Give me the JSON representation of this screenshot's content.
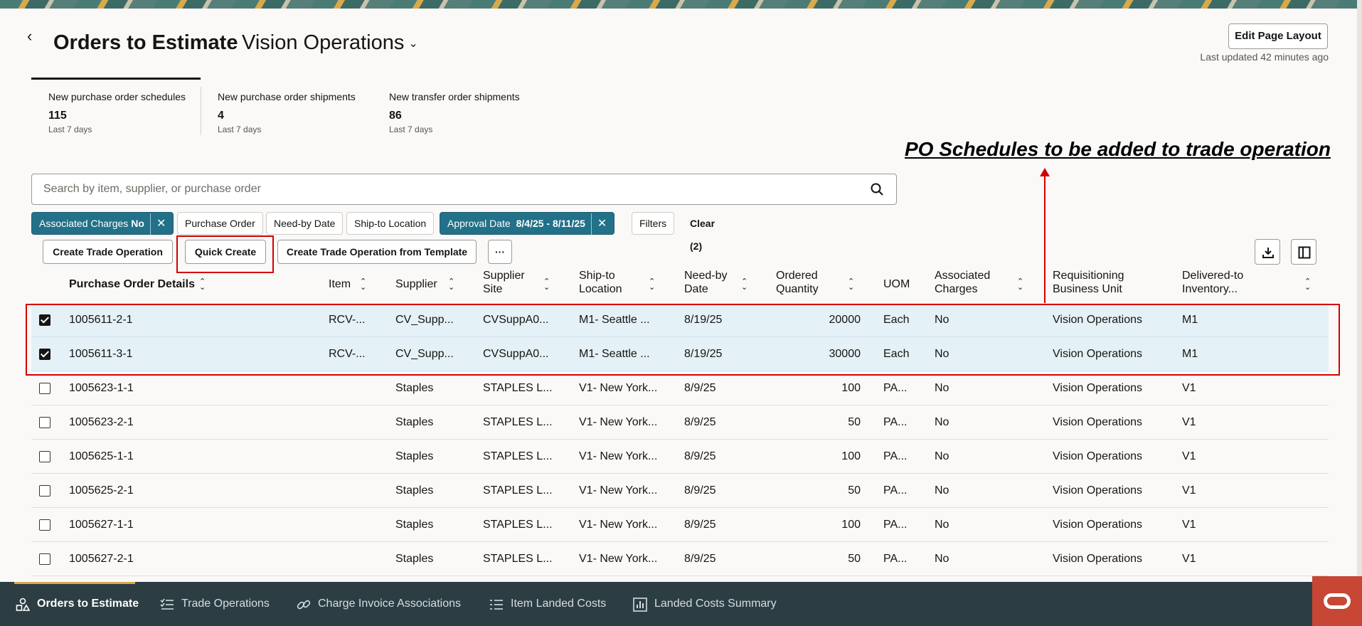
{
  "header": {
    "title": "Orders to Estimate",
    "context": "Vision Operations",
    "edit_layout_label": "Edit Page Layout",
    "last_updated": "Last updated 42 minutes ago"
  },
  "metrics": [
    {
      "label": "New purchase order schedules",
      "value": "115",
      "sub": "Last 7 days"
    },
    {
      "label": "New purchase order shipments",
      "value": "4",
      "sub": "Last 7 days"
    },
    {
      "label": "New transfer order shipments",
      "value": "86",
      "sub": "Last 7 days"
    }
  ],
  "annotation": "PO Schedules to be added to trade operation",
  "search": {
    "placeholder": "Search by item, supplier, or purchase order"
  },
  "chips": [
    {
      "label": "Associated Charges",
      "value": "No",
      "active": true
    },
    {
      "label": "Purchase Order"
    },
    {
      "label": "Need-by Date"
    },
    {
      "label": "Ship-to Location"
    },
    {
      "label": "Approval Date",
      "value": "8/4/25 - 8/11/25",
      "active": true
    },
    {
      "label": "Filters"
    }
  ],
  "clear_label": "Clear (2)",
  "toolbar": {
    "create_trade_operation": "Create Trade Operation",
    "quick_create": "Quick Create",
    "create_from_template": "Create Trade Operation from Template",
    "more": "···"
  },
  "columns": {
    "po_details": "Purchase Order Details",
    "item": "Item",
    "supplier": "Supplier",
    "supplier_site": "Supplier Site",
    "ship_to": "Ship-to Location",
    "need_by": "Need-by Date",
    "ordered_qty": "Ordered Quantity",
    "uom": "UOM",
    "assoc_charges": "Associated Charges",
    "req_bu": "Requisitioning Business Unit",
    "delivered_to": "Delivered-to Inventory..."
  },
  "rows": [
    {
      "po": "1005611-2-1",
      "item": "RCV-...",
      "supplier": "CV_Supp...",
      "site": "CVSuppA0...",
      "ship_to": "M1- Seattle ...",
      "need_by": "8/19/25",
      "qty": "20000",
      "uom": "Each",
      "charges": "No",
      "bu": "Vision Operations",
      "delivered": "M1",
      "selected": true
    },
    {
      "po": "1005611-3-1",
      "item": "RCV-...",
      "supplier": "CV_Supp...",
      "site": "CVSuppA0...",
      "ship_to": "M1- Seattle ...",
      "need_by": "8/19/25",
      "qty": "30000",
      "uom": "Each",
      "charges": "No",
      "bu": "Vision Operations",
      "delivered": "M1",
      "selected": true
    },
    {
      "po": "1005623-1-1",
      "item": "",
      "supplier": "Staples",
      "site": "STAPLES L...",
      "ship_to": "V1- New York...",
      "need_by": "8/9/25",
      "qty": "100",
      "uom": "PA...",
      "charges": "No",
      "bu": "Vision Operations",
      "delivered": "V1",
      "selected": false
    },
    {
      "po": "1005623-2-1",
      "item": "",
      "supplier": "Staples",
      "site": "STAPLES L...",
      "ship_to": "V1- New York...",
      "need_by": "8/9/25",
      "qty": "50",
      "uom": "PA...",
      "charges": "No",
      "bu": "Vision Operations",
      "delivered": "V1",
      "selected": false
    },
    {
      "po": "1005625-1-1",
      "item": "",
      "supplier": "Staples",
      "site": "STAPLES L...",
      "ship_to": "V1- New York...",
      "need_by": "8/9/25",
      "qty": "100",
      "uom": "PA...",
      "charges": "No",
      "bu": "Vision Operations",
      "delivered": "V1",
      "selected": false
    },
    {
      "po": "1005625-2-1",
      "item": "",
      "supplier": "Staples",
      "site": "STAPLES L...",
      "ship_to": "V1- New York...",
      "need_by": "8/9/25",
      "qty": "50",
      "uom": "PA...",
      "charges": "No",
      "bu": "Vision Operations",
      "delivered": "V1",
      "selected": false
    },
    {
      "po": "1005627-1-1",
      "item": "",
      "supplier": "Staples",
      "site": "STAPLES L...",
      "ship_to": "V1- New York...",
      "need_by": "8/9/25",
      "qty": "100",
      "uom": "PA...",
      "charges": "No",
      "bu": "Vision Operations",
      "delivered": "V1",
      "selected": false
    },
    {
      "po": "1005627-2-1",
      "item": "",
      "supplier": "Staples",
      "site": "STAPLES L...",
      "ship_to": "V1- New York...",
      "need_by": "8/9/25",
      "qty": "50",
      "uom": "PA...",
      "charges": "No",
      "bu": "Vision Operations",
      "delivered": "V1",
      "selected": false
    }
  ],
  "nav": [
    {
      "label": "Orders to Estimate",
      "icon": "shapes-icon",
      "active": true
    },
    {
      "label": "Trade Operations",
      "icon": "checklist-icon"
    },
    {
      "label": "Charge Invoice Associations",
      "icon": "link-icon"
    },
    {
      "label": "Item Landed Costs",
      "icon": "list-icon"
    },
    {
      "label": "Landed Costs Summary",
      "icon": "bar-chart-icon"
    }
  ],
  "colors": {
    "accent": "#227189",
    "highlight": "#d40000",
    "nav_bg": "#2c3e44",
    "brand": "#c74634"
  }
}
